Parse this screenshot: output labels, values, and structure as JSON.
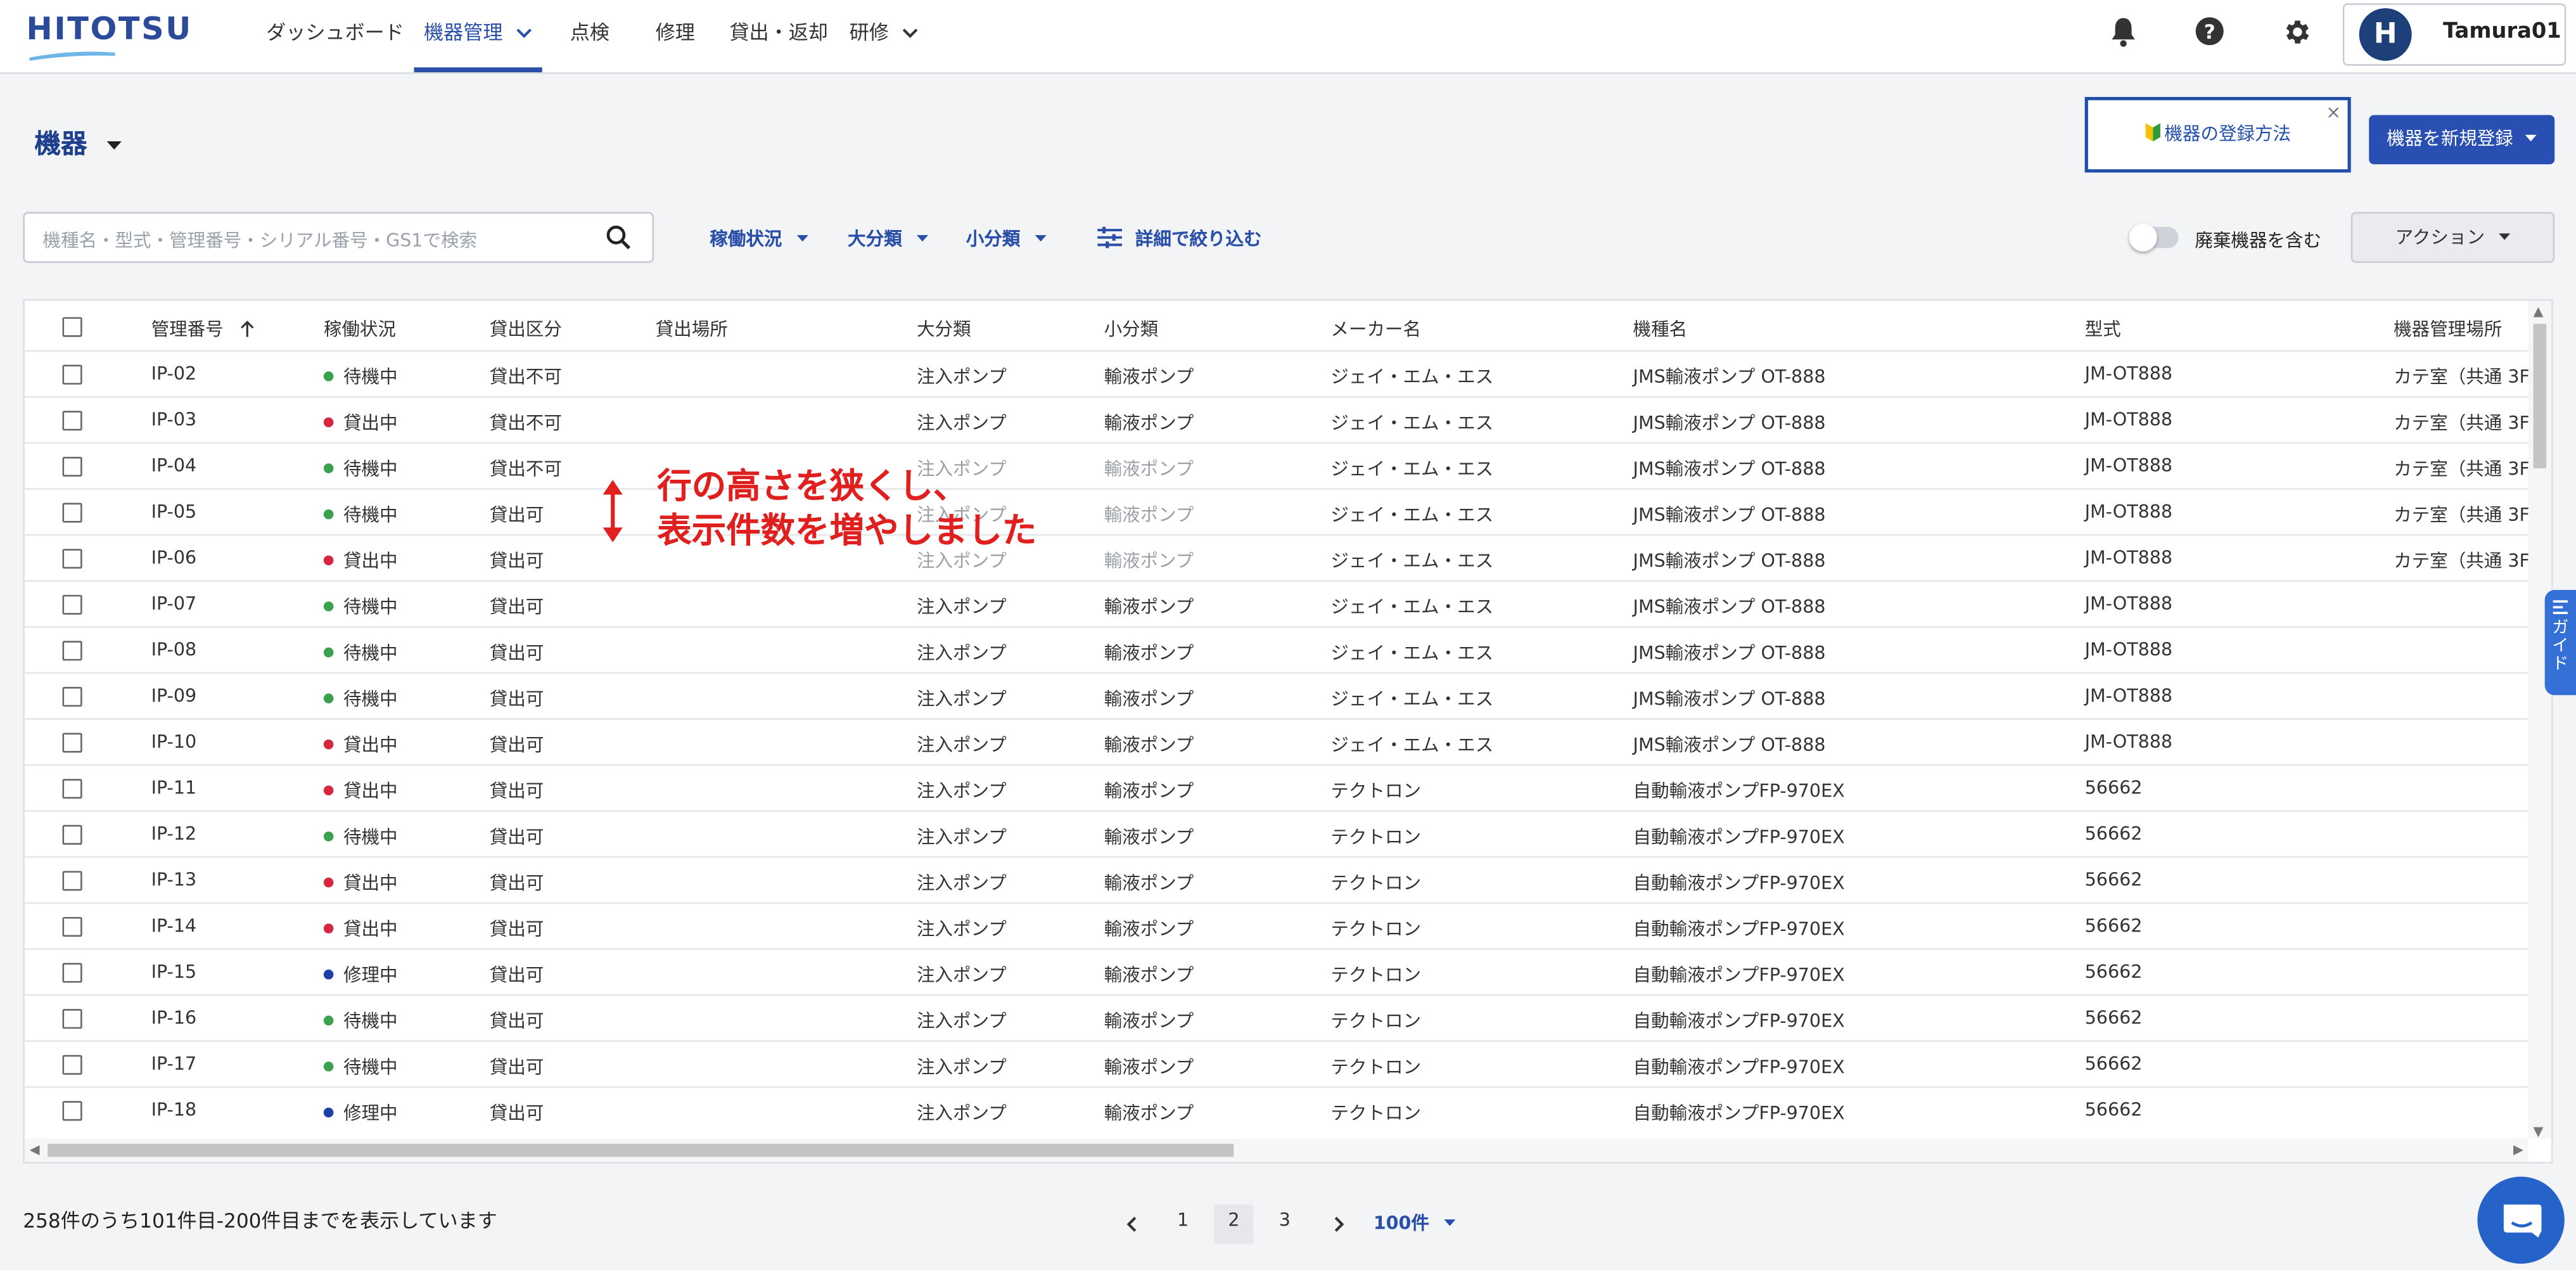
{
  "brand": {
    "logo_text": "HITOTSU"
  },
  "nav": {
    "dashboard": "ダッシュボード",
    "equipment": "機器管理",
    "inspection": "点検",
    "repair": "修理",
    "lending": "貸出・返却",
    "training": "研修"
  },
  "user": {
    "initial": "H",
    "name": "Tamura01"
  },
  "header": {
    "title": "機器",
    "howto_label": "機器の登録方法",
    "howto_close": "×",
    "new_button": "機器を新規登録"
  },
  "filters": {
    "search_placeholder": "機種名・型式・管理番号・シリアル番号・GS1で検索",
    "status": "稼働状況",
    "major": "大分類",
    "minor": "小分類",
    "detail": "詳細で絞り込む",
    "include_disposed": "廃棄機器を含む",
    "action": "アクション"
  },
  "table": {
    "columns": [
      "管理番号",
      "稼働状況",
      "貸出区分",
      "貸出場所",
      "大分類",
      "小分類",
      "メーカー名",
      "機種名",
      "型式",
      "機器管理場所"
    ],
    "rows": [
      {
        "id": "IP-02",
        "status": "待機中",
        "color": "#3aa14c",
        "lend": "貸出不可",
        "place": "",
        "major": "注入ポンプ",
        "minor": "輸液ポンプ",
        "maker": "ジェイ・エム・エス",
        "model": "JMS輸液ポンプ OT-888",
        "type": "JM-OT888",
        "loc": "カテ室（共通 3F"
      },
      {
        "id": "IP-03",
        "status": "貸出中",
        "color": "#d7263d",
        "lend": "貸出不可",
        "place": "",
        "major": "注入ポンプ",
        "minor": "輸液ポンプ",
        "maker": "ジェイ・エム・エス",
        "model": "JMS輸液ポンプ OT-888",
        "type": "JM-OT888",
        "loc": "カテ室（共通 3F"
      },
      {
        "id": "IP-04",
        "status": "待機中",
        "color": "#3aa14c",
        "lend": "貸出不可",
        "place": "",
        "major": "注入ポンプ",
        "minor": "輸液ポンプ",
        "maker": "ジェイ・エム・エス",
        "model": "JMS輸液ポンプ OT-888",
        "type": "JM-OT888",
        "loc": "カテ室（共通 3F"
      },
      {
        "id": "IP-05",
        "status": "待機中",
        "color": "#3aa14c",
        "lend": "貸出可",
        "place": "",
        "major": "注入ポンプ",
        "minor": "輸液ポンプ",
        "maker": "ジェイ・エム・エス",
        "model": "JMS輸液ポンプ OT-888",
        "type": "JM-OT888",
        "loc": "カテ室（共通 3F"
      },
      {
        "id": "IP-06",
        "status": "貸出中",
        "color": "#d7263d",
        "lend": "貸出可",
        "place": "",
        "major": "注入ポンプ",
        "minor": "輸液ポンプ",
        "maker": "ジェイ・エム・エス",
        "model": "JMS輸液ポンプ OT-888",
        "type": "JM-OT888",
        "loc": "カテ室（共通 3F"
      },
      {
        "id": "IP-07",
        "status": "待機中",
        "color": "#3aa14c",
        "lend": "貸出可",
        "place": "",
        "major": "注入ポンプ",
        "minor": "輸液ポンプ",
        "maker": "ジェイ・エム・エス",
        "model": "JMS輸液ポンプ OT-888",
        "type": "JM-OT888",
        "loc": ""
      },
      {
        "id": "IP-08",
        "status": "待機中",
        "color": "#3aa14c",
        "lend": "貸出可",
        "place": "",
        "major": "注入ポンプ",
        "minor": "輸液ポンプ",
        "maker": "ジェイ・エム・エス",
        "model": "JMS輸液ポンプ OT-888",
        "type": "JM-OT888",
        "loc": ""
      },
      {
        "id": "IP-09",
        "status": "待機中",
        "color": "#3aa14c",
        "lend": "貸出可",
        "place": "",
        "major": "注入ポンプ",
        "minor": "輸液ポンプ",
        "maker": "ジェイ・エム・エス",
        "model": "JMS輸液ポンプ OT-888",
        "type": "JM-OT888",
        "loc": ""
      },
      {
        "id": "IP-10",
        "status": "貸出中",
        "color": "#d7263d",
        "lend": "貸出可",
        "place": "",
        "major": "注入ポンプ",
        "minor": "輸液ポンプ",
        "maker": "ジェイ・エム・エス",
        "model": "JMS輸液ポンプ OT-888",
        "type": "JM-OT888",
        "loc": ""
      },
      {
        "id": "IP-11",
        "status": "貸出中",
        "color": "#d7263d",
        "lend": "貸出可",
        "place": "",
        "major": "注入ポンプ",
        "minor": "輸液ポンプ",
        "maker": "テクトロン",
        "model": "自動輸液ポンプFP-970EX",
        "type": "56662",
        "loc": ""
      },
      {
        "id": "IP-12",
        "status": "待機中",
        "color": "#3aa14c",
        "lend": "貸出可",
        "place": "",
        "major": "注入ポンプ",
        "minor": "輸液ポンプ",
        "maker": "テクトロン",
        "model": "自動輸液ポンプFP-970EX",
        "type": "56662",
        "loc": ""
      },
      {
        "id": "IP-13",
        "status": "貸出中",
        "color": "#d7263d",
        "lend": "貸出可",
        "place": "",
        "major": "注入ポンプ",
        "minor": "輸液ポンプ",
        "maker": "テクトロン",
        "model": "自動輸液ポンプFP-970EX",
        "type": "56662",
        "loc": ""
      },
      {
        "id": "IP-14",
        "status": "貸出中",
        "color": "#d7263d",
        "lend": "貸出可",
        "place": "",
        "major": "注入ポンプ",
        "minor": "輸液ポンプ",
        "maker": "テクトロン",
        "model": "自動輸液ポンプFP-970EX",
        "type": "56662",
        "loc": ""
      },
      {
        "id": "IP-15",
        "status": "修理中",
        "color": "#1f3fa8",
        "lend": "貸出可",
        "place": "",
        "major": "注入ポンプ",
        "minor": "輸液ポンプ",
        "maker": "テクトロン",
        "model": "自動輸液ポンプFP-970EX",
        "type": "56662",
        "loc": ""
      },
      {
        "id": "IP-16",
        "status": "待機中",
        "color": "#3aa14c",
        "lend": "貸出可",
        "place": "",
        "major": "注入ポンプ",
        "minor": "輸液ポンプ",
        "maker": "テクトロン",
        "model": "自動輸液ポンプFP-970EX",
        "type": "56662",
        "loc": ""
      },
      {
        "id": "IP-17",
        "status": "待機中",
        "color": "#3aa14c",
        "lend": "貸出可",
        "place": "",
        "major": "注入ポンプ",
        "minor": "輸液ポンプ",
        "maker": "テクトロン",
        "model": "自動輸液ポンプFP-970EX",
        "type": "56662",
        "loc": ""
      },
      {
        "id": "IP-18",
        "status": "修理中",
        "color": "#1f3fa8",
        "lend": "貸出可",
        "place": "",
        "major": "注入ポンプ",
        "minor": "輸液ポンプ",
        "maker": "テクトロン",
        "model": "自動輸液ポンプFP-970EX",
        "type": "56662",
        "loc": ""
      }
    ]
  },
  "annotation": {
    "line1": "行の高さを狭くし、",
    "line2": "表示件数を増やしました"
  },
  "guide_tab": {
    "label": "ガイド"
  },
  "footer": {
    "summary": "258件のうち101件目-200件目までを表示しています",
    "pages": [
      "1",
      "2",
      "3"
    ],
    "current_page": "2",
    "per_page": "100件"
  }
}
